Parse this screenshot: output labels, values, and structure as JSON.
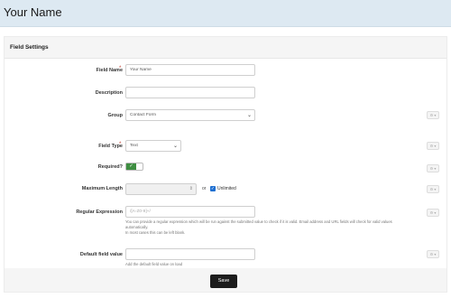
{
  "header": {
    "title": "Your Name"
  },
  "panel": {
    "title": "Field Settings"
  },
  "fields": {
    "field_name": {
      "label": "Field Name",
      "required_marker": "*",
      "value": "Your Name"
    },
    "description": {
      "label": "Description",
      "value": ""
    },
    "group": {
      "label": "Group",
      "selected": "Contact Form"
    },
    "field_type": {
      "label": "Field Type",
      "required_marker": "*",
      "selected": "Text"
    },
    "required": {
      "label": "Required?",
      "toggle_state": "✓",
      "checked": true
    },
    "max_length": {
      "label": "Maximum Length",
      "or_text": "or",
      "unlimited_label": "Unlimited",
      "unlimited_checked": true
    },
    "regex": {
      "label": "Regular Expression",
      "placeholder": "/[A-Z0-9]+/",
      "help_line1": "You can provide a regular expression which will be run against the submitted value to check if it is valid. Email address and URL fields will check for valid values",
      "help_line2": "automatically.",
      "help_line3": "In most cases this can be left blank."
    },
    "default_value": {
      "label": "Default field value",
      "value": "",
      "help": "Add the default field value on load"
    }
  },
  "side_button": {
    "text": "⚙ ▾"
  },
  "footer": {
    "save_label": "Save"
  }
}
